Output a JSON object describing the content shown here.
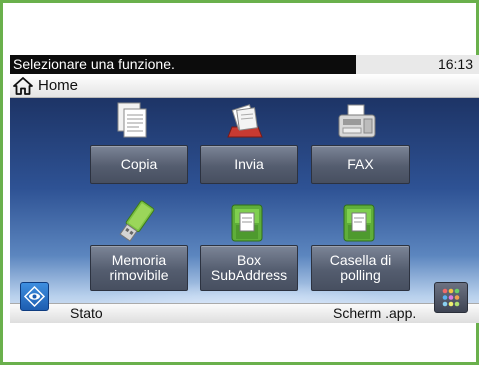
{
  "status_bar": {
    "message": "Selezionare una funzione.",
    "time": "16:13"
  },
  "home_bar": {
    "label": "Home",
    "icon": "home-icon"
  },
  "functions": [
    {
      "label": "Copia",
      "icon": "documents-icon"
    },
    {
      "label": "Invia",
      "icon": "send-documents-icon"
    },
    {
      "label": "FAX",
      "icon": "fax-machine-icon"
    },
    {
      "label": "Memoria rimovibile",
      "line1": "Memoria",
      "line2": "rimovibile",
      "icon": "usb-drive-icon"
    },
    {
      "label": "Box SubAddress",
      "line1": "Box",
      "line2": "SubAddress",
      "icon": "document-box-icon"
    },
    {
      "label": "Casella di polling",
      "line1": "Casella di",
      "line2": "polling",
      "icon": "polling-box-icon"
    }
  ],
  "bottom_bar": {
    "status_label": "Stato",
    "status_icon": "eye-icon",
    "app_screen_label": "Scherm .app.",
    "app_screen_icon": "apps-grid-icon"
  },
  "colors": {
    "frame": "#6ab04c",
    "button": "#5a6375",
    "status_bar": "#0c0c0c"
  }
}
